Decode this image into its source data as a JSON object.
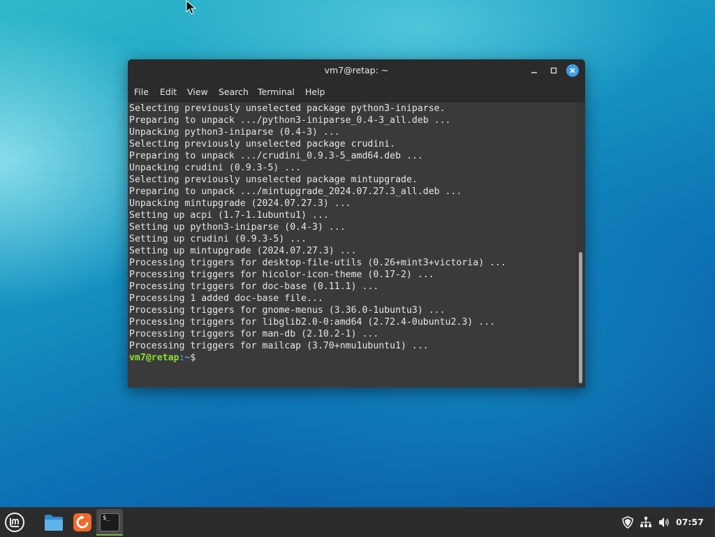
{
  "window": {
    "title": "vm7@retap: ~",
    "controls": [
      "minimize-icon",
      "maximize-icon",
      "close-icon"
    ]
  },
  "menubar": {
    "items": [
      "File",
      "Edit",
      "View",
      "Search",
      "Terminal",
      "Help"
    ]
  },
  "terminal": {
    "lines": [
      "Selecting previously unselected package python3-iniparse.",
      "Preparing to unpack .../python3-iniparse_0.4-3_all.deb ...",
      "Unpacking python3-iniparse (0.4-3) ...",
      "Selecting previously unselected package crudini.",
      "Preparing to unpack .../crudini_0.9.3-5_amd64.deb ...",
      "Unpacking crudini (0.9.3-5) ...",
      "Selecting previously unselected package mintupgrade.",
      "Preparing to unpack .../mintupgrade_2024.07.27.3_all.deb ...",
      "Unpacking mintupgrade (2024.07.27.3) ...",
      "Setting up acpi (1.7-1.1ubuntu1) ...",
      "Setting up python3-iniparse (0.4-3) ...",
      "Setting up crudini (0.9.3-5) ...",
      "Setting up mintupgrade (2024.07.27.3) ...",
      "Processing triggers for desktop-file-utils (0.26+mint3+victoria) ...",
      "Processing triggers for hicolor-icon-theme (0.17-2) ...",
      "Processing triggers for doc-base (0.11.1) ...",
      "Processing 1 added doc-base file...",
      "Processing triggers for gnome-menus (3.36.0-1ubuntu3) ...",
      "Processing triggers for libglib2.0-0:amd64 (2.72.4-0ubuntu2.3) ...",
      "Processing triggers for man-db (2.10.2-1) ...",
      "Processing triggers for mailcap (3.70+nmu1ubuntu1) ..."
    ],
    "prompt": {
      "user_host": "vm7@retap",
      "path": ":~",
      "symbol": "$"
    }
  },
  "taskbar": {
    "launchers": [
      "mint-menu-icon",
      "files-icon",
      "update-manager-icon",
      "terminal-icon"
    ],
    "terminal_icon_text": "$_",
    "tray": [
      "shield-icon",
      "network-icon",
      "volume-icon"
    ],
    "clock": "07:57"
  },
  "colors": {
    "prompt_user": "#8ae234",
    "prompt_path": "#729fcf",
    "close_button": "#3d9ee6",
    "active_indicator": "#7dbb3e"
  }
}
